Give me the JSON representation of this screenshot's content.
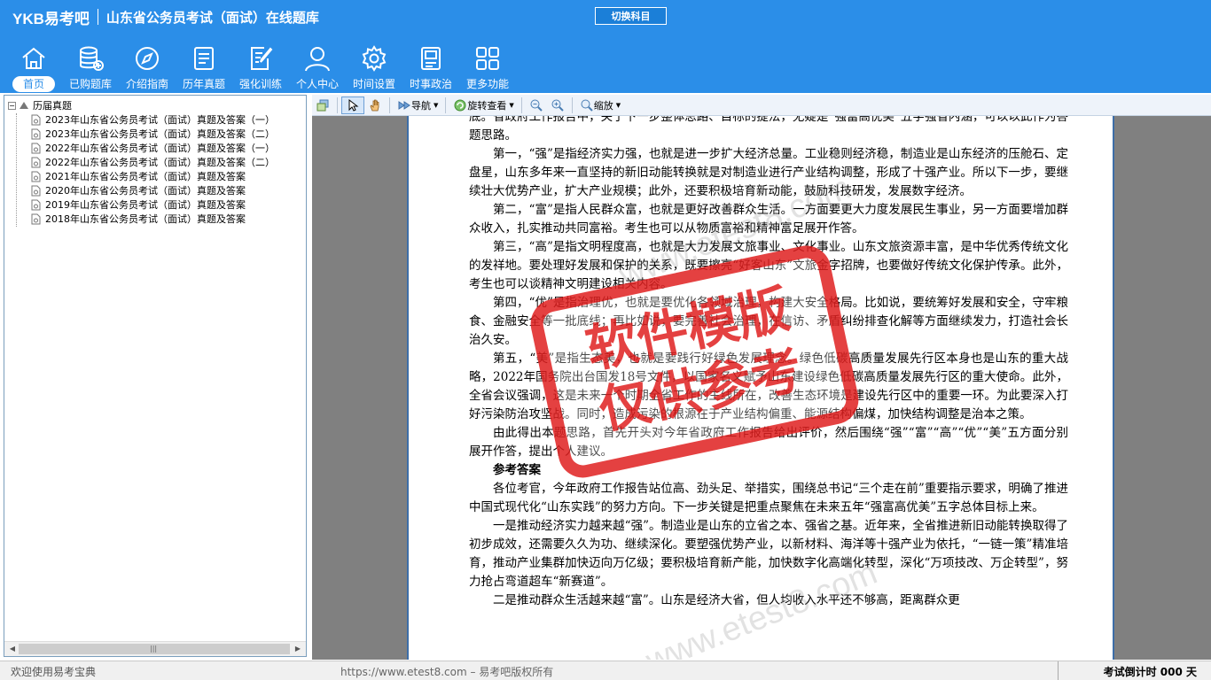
{
  "header": {
    "logo": "YKB易考吧",
    "title": "山东省公务员考试（面试）在线题库",
    "switch_button": "切换科目"
  },
  "nav": [
    {
      "label": "首页",
      "icon": "home-icon"
    },
    {
      "label": "已购题库",
      "icon": "database-icon"
    },
    {
      "label": "介绍指南",
      "icon": "compass-icon"
    },
    {
      "label": "历年真题",
      "icon": "list-doc-icon"
    },
    {
      "label": "强化训练",
      "icon": "edit-doc-icon"
    },
    {
      "label": "个人中心",
      "icon": "user-icon"
    },
    {
      "label": "时间设置",
      "icon": "gear-icon"
    },
    {
      "label": "时事政治",
      "icon": "book-icon"
    },
    {
      "label": "更多功能",
      "icon": "grid-icon"
    }
  ],
  "tree": {
    "root": "历届真题",
    "items": [
      "2023年山东省公务员考试（面试）真题及答案（一）",
      "2023年山东省公务员考试（面试）真题及答案（二）",
      "2022年山东省公务员考试（面试）真题及答案（一）",
      "2022年山东省公务员考试（面试）真题及答案（二）",
      "2021年山东省公务员考试（面试）真题及答案",
      "2020年山东省公务员考试（面试）真题及答案",
      "2019年山东省公务员考试（面试）真题及答案",
      "2018年山东省公务员考试（面试）真题及答案"
    ]
  },
  "toolbar": {
    "nav_label": "导航",
    "rotate_label": "旋转查看",
    "zoom_label": "缩放"
  },
  "document": {
    "paragraphs": [
      {
        "text": "底。省政府工作报告中，关于下一步整体思路、目标的提法，无疑是“强富高优美”五字强省内涵，可以以此作为答题思路。",
        "indent": false
      },
      {
        "text": "第一，“强”是指经济实力强，也就是进一步扩大经济总量。工业稳则经济稳，制造业是山东经济的压舱石、定盘星，山东多年来一直坚持的新旧动能转换就是对制造业进行产业结构调整，形成了十强产业。所以下一步，要继续壮大优势产业，扩大产业规模；此外，还要积极培育新动能，鼓励科技研发，发展数字经济。",
        "indent": true
      },
      {
        "text": "第二，“富”是指人民群众富，也就是更好改善群众生活。一方面要更大力度发展民生事业，另一方面要增加群众收入，扎实推动共同富裕。考生也可以从物质富裕和精神富足展开作答。",
        "indent": true
      },
      {
        "text": "第三，“高”是指文明程度高，也就是大力发展文旅事业、文化事业。山东文旅资源丰富，是中华优秀传统文化的发祥地。要处理好发展和保护的关系，既要擦亮“好客山东”文旅金字招牌，也要做好传统文化保护传承。此外，考生也可以谈精神文明建设相关内容。",
        "indent": true
      },
      {
        "text": "第四，“优”是指治理优，也就是要优化各领域治理，构建大安全格局。比如说，要统筹好发展和安全，守牢粮食、金融安全等一批底线；再比如说，要完善社会治理，在信访、矛盾纠纷排查化解等方面继续发力，打造社会长治久安。",
        "indent": true
      },
      {
        "text": "第五，“美”是指生态美，也就是要践行好绿色发展理念。绿色低碳高质量发展先行区本身也是山东的重大战略，2022年国务院出台国发18号文件，以国家名义赋予山东建设绿色低碳高质量发展先行区的重大使命。此外，全省会议强调，这是未来一个时期全省工作的主线所在，改善生态环境是建设先行区中的重要一环。为此要深入打好污染防治攻坚战。同时，造成污染的根源在于产业结构偏重、能源结构偏煤，加快结构调整是治本之策。",
        "indent": true
      },
      {
        "text": "由此得出本题思路，首先开头对今年省政府工作报告给出评价，然后围绕“强”“富”“高”“优”“美”五方面分别展开作答，提出个人建议。",
        "indent": true
      },
      {
        "text": "参考答案",
        "indent": true,
        "heading": true
      },
      {
        "text": "各位考官，今年政府工作报告站位高、劲头足、举措实，围绕总书记“三个走在前”重要指示要求，明确了推进中国式现代化“山东实践”的努力方向。下一步关键是把重点聚焦在未来五年“强富高优美”五字总体目标上来。",
        "indent": true
      },
      {
        "text": "一是推动经济实力越来越“强”。制造业是山东的立省之本、强省之基。近年来，全省推进新旧动能转换取得了初步成效，还需要久久为功、继续深化。要塑强优势产业，以新材料、海洋等十强产业为依托，“一链一策”精准培育，推动产业集群加快迈向万亿级；要积极培育新产能，加快数字化高端化转型，深化“万项技改、万企转型”，努力抢占弯道超车“新赛道”。",
        "indent": true
      },
      {
        "text": "二是推动群众生活越来越“富”。山东是经济大省，但人均收入水平还不够高，距离群众更",
        "indent": true
      }
    ],
    "watermark_text_line1": "软件模版",
    "watermark_text_line2": "仅供参考"
  },
  "status": {
    "left": "欢迎使用易考宝典",
    "center": "https://www.etest8.com – 易考吧版权所有",
    "right": "考试倒计时 000 天"
  },
  "colors": {
    "header_bg": "#2b8ee8",
    "watermark": "#e02020"
  }
}
